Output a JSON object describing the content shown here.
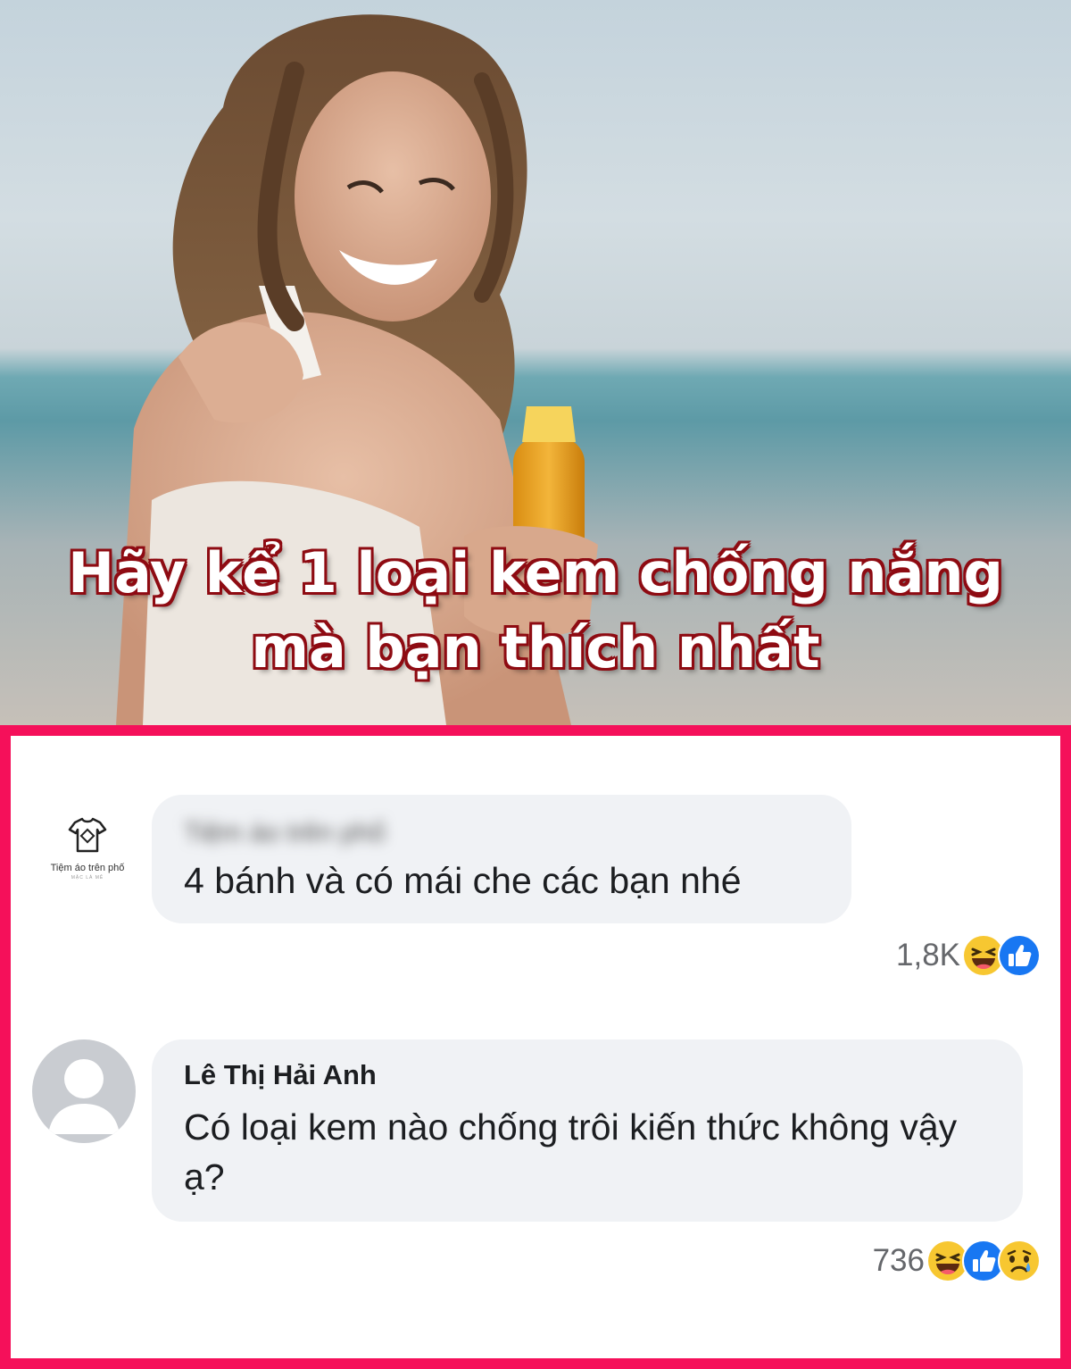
{
  "post": {
    "headline_line1": "Hãy kể 1 loại kem chống nắng",
    "headline_line2": "mà bạn thích nhất",
    "colors": {
      "frame": "#f5105a",
      "headline_outline": "#8e0b12",
      "bubble": "#f0f2f5"
    }
  },
  "comments": [
    {
      "author": "Tiệm áo trên phố",
      "avatar_label": "Tiệm áo trên phố",
      "avatar_sub": "MẶC LÀ MÊ",
      "avatar_icon": "tshirt-logo-icon",
      "name_blurred": true,
      "text": "4 bánh và có mái che các bạn nhé",
      "reaction_count": "1,8K",
      "reactions": [
        "haha-icon",
        "like-icon"
      ]
    },
    {
      "author": "Lê Thị Hải Anh",
      "avatar_icon": "default-user-icon",
      "text": "Có loại kem nào chống trôi kiến thức không vậy ạ?",
      "reaction_count": "736",
      "reactions": [
        "haha-icon",
        "like-icon",
        "sad-icon"
      ]
    }
  ]
}
